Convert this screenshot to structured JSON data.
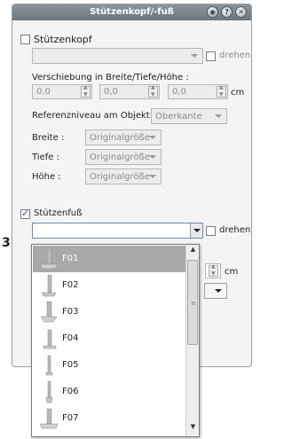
{
  "window": {
    "title": "Stützenkopf/-fuß"
  },
  "titlebar_buttons": [
    {
      "icon": "pin-icon",
      "glyph": "◉"
    },
    {
      "icon": "help-icon",
      "glyph": "?"
    },
    {
      "icon": "close-icon",
      "glyph": "✕"
    }
  ],
  "kopf": {
    "checkbox_label": "Stützenkopf",
    "checked": false,
    "drehen_label": "drehen",
    "verschiebung_label": "Verschiebung in Breite/Tiefe/Höhe :",
    "offsets": [
      "0,0",
      "0,0",
      "0,0"
    ],
    "unit": "cm",
    "referenz_label": "Referenzniveau am Objekt:",
    "referenz_value": "Oberkante",
    "breite_label": "Breite :",
    "breite_value": "Originalgröße",
    "tiefe_label": "Tiefe :",
    "tiefe_value": "Originalgröße",
    "hoehe_label": "Höhe :",
    "hoehe_value": "Originalgröße"
  },
  "fuss": {
    "checkbox_label": "Stützenfuß",
    "checked": true,
    "drehen_label": "drehen",
    "unit": "cm"
  },
  "side_marker": "3",
  "dropdown": {
    "items": [
      "F01",
      "F02",
      "F03",
      "F04",
      "F05",
      "F06",
      "F07"
    ],
    "selected_index": 0,
    "scroll_grip": "≡"
  },
  "colors": {
    "titlebar": "#7b838b",
    "selection": "#a8a8a8",
    "accent": "#1a4fa0"
  }
}
